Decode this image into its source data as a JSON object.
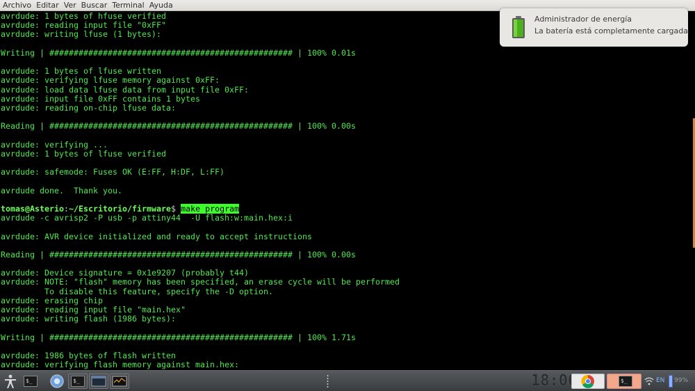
{
  "menubar": {
    "items": [
      "Archivo",
      "Editar",
      "Ver",
      "Buscar",
      "Terminal",
      "Ayuda"
    ]
  },
  "terminal": {
    "lines_before": [
      "avrdude: 1 bytes of hfuse verified",
      "avrdude: reading input file \"0xFF\"",
      "avrdude: writing lfuse (1 bytes):",
      "",
      "Writing | ################################################## | 100% 0.01s",
      "",
      "avrdude: 1 bytes of lfuse written",
      "avrdude: verifying lfuse memory against 0xFF:",
      "avrdude: load data lfuse data from input file 0xFF:",
      "avrdude: input file 0xFF contains 1 bytes",
      "avrdude: reading on-chip lfuse data:",
      "",
      "Reading | ################################################## | 100% 0.00s",
      "",
      "avrdude: verifying ...",
      "avrdude: 1 bytes of lfuse verified",
      "",
      "avrdude: safemode: Fuses OK (E:FF, H:DF, L:FF)",
      "",
      "avrdude done.  Thank you.",
      ""
    ],
    "prompt_user": "tomas@Asterio",
    "prompt_sep": ":",
    "prompt_path": "~/Escritorio/firmware",
    "prompt_symbol": "$ ",
    "typed_command": "make program",
    "lines_after": [
      "avrdude -c avrisp2 -P usb -p attiny44  -U flash:w:main.hex:i",
      "",
      "avrdude: AVR device initialized and ready to accept instructions",
      "",
      "Reading | ################################################## | 100% 0.00s",
      "",
      "avrdude: Device signature = 0x1e9207 (probably t44)",
      "avrdude: NOTE: \"flash\" memory has been specified, an erase cycle will be performed",
      "         To disable this feature, specify the -D option.",
      "avrdude: erasing chip",
      "avrdude: reading input file \"main.hex\"",
      "avrdude: writing flash (1986 bytes):",
      "",
      "Writing | ################################################## | 100% 1.71s",
      "",
      "avrdude: 1986 bytes of flash written",
      "avrdude: verifying flash memory against main.hex:"
    ]
  },
  "notification": {
    "title": "Administrador de energía",
    "body": "La batería está completamente cargada",
    "icon": "battery-full-icon"
  },
  "taskbar": {
    "clock": "18:06",
    "language": "EN",
    "battery": "99%"
  },
  "colors": {
    "terminal_fg": "#4ee84e",
    "terminal_bg": "#000000",
    "highlight": "#3cff2a"
  }
}
